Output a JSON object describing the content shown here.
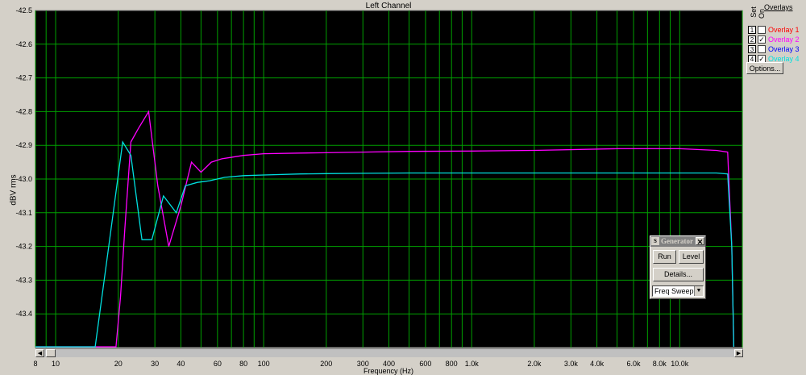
{
  "chart_data": {
    "type": "line",
    "title": "Left Channel",
    "xlabel": "Frequency (Hz)",
    "ylabel": "dBV rms",
    "x_scale": "log",
    "xlim": [
      8,
      20000
    ],
    "ylim": [
      -43.5,
      -42.5
    ],
    "grid": true,
    "legend_position": "top-right",
    "y_ticks": [
      -42.5,
      -42.6,
      -42.7,
      -42.8,
      -42.9,
      -43.0,
      -43.1,
      -43.2,
      -43.3,
      -43.4
    ],
    "y_tick_labels": [
      "-42.5",
      "-42.6",
      "-42.7",
      "-42.8",
      "-42.9",
      "-43.0",
      "-43.1",
      "-43.2",
      "-43.3",
      "-43.4"
    ],
    "x_tick_values": [
      8,
      10,
      20,
      30,
      40,
      60,
      80,
      100,
      200,
      300,
      400,
      600,
      800,
      1000,
      2000,
      3000,
      4000,
      6000,
      8000,
      10000
    ],
    "x_tick_labels": [
      "8",
      "10",
      "20",
      "30",
      "40",
      "60",
      "80",
      "100",
      "200",
      "300",
      "400",
      "600",
      "800",
      "1.0k",
      "2.0k",
      "3.0k",
      "4.0k",
      "6.0k",
      "8.0k",
      "10.0k"
    ],
    "series": [
      {
        "name": "Overlay 2",
        "color": "#ff00ff",
        "x": [
          8,
          16,
          19.5,
          20.5,
          21.5,
          23,
          25,
          28,
          31,
          35,
          40,
          45,
          50,
          56,
          63,
          71,
          80,
          100,
          150,
          200,
          300,
          500,
          1000,
          2000,
          5000,
          10000,
          15000,
          17000,
          17800,
          18200
        ],
        "y": [
          -43.52,
          -43.52,
          -43.52,
          -43.35,
          -43.15,
          -42.89,
          -42.85,
          -42.8,
          -43.02,
          -43.2,
          -43.08,
          -42.95,
          -42.98,
          -42.95,
          -42.94,
          -42.935,
          -42.93,
          -42.925,
          -42.923,
          -42.922,
          -42.92,
          -42.918,
          -42.917,
          -42.915,
          -42.91,
          -42.91,
          -42.915,
          -42.92,
          -43.2,
          -43.52
        ]
      },
      {
        "name": "Overlay 4",
        "color": "#00e0e0",
        "x": [
          8,
          13.5,
          15.5,
          18,
          21,
          23,
          26,
          29,
          33,
          38,
          42,
          48,
          55,
          65,
          80,
          100,
          150,
          200,
          300,
          500,
          1000,
          2000,
          5000,
          10000,
          15000,
          17000,
          17800,
          18200
        ],
        "y": [
          -43.52,
          -43.52,
          -43.5,
          -43.2,
          -42.89,
          -42.93,
          -43.18,
          -43.18,
          -43.05,
          -43.1,
          -43.02,
          -43.01,
          -43.005,
          -42.995,
          -42.99,
          -42.988,
          -42.985,
          -42.984,
          -42.983,
          -42.982,
          -42.982,
          -42.982,
          -42.982,
          -42.982,
          -42.982,
          -42.985,
          -43.2,
          -43.52
        ]
      }
    ]
  },
  "overlays": {
    "header_set": "Set",
    "header_on": "On",
    "title": "Overlays",
    "items": [
      {
        "num": "1",
        "label": "Overlay 1",
        "checked": false,
        "color": "#ff0000"
      },
      {
        "num": "2",
        "label": "Overlay 2",
        "checked": true,
        "color": "#ff00ff"
      },
      {
        "num": "3",
        "label": "Overlay 3",
        "checked": false,
        "color": "#0000ff"
      },
      {
        "num": "4",
        "label": "Overlay 4",
        "checked": true,
        "color": "#00e0e0"
      }
    ],
    "options_label": "Options..."
  },
  "generator": {
    "icon": "S",
    "title": "Generator",
    "close": "✕",
    "run_label": "Run",
    "level_label": "Level",
    "details_label": "Details...",
    "mode_value": "Freq Sweep",
    "dropdown_arrow": "▼"
  },
  "scrollbar": {
    "left_arrow": "◀",
    "right_arrow": "▶"
  }
}
